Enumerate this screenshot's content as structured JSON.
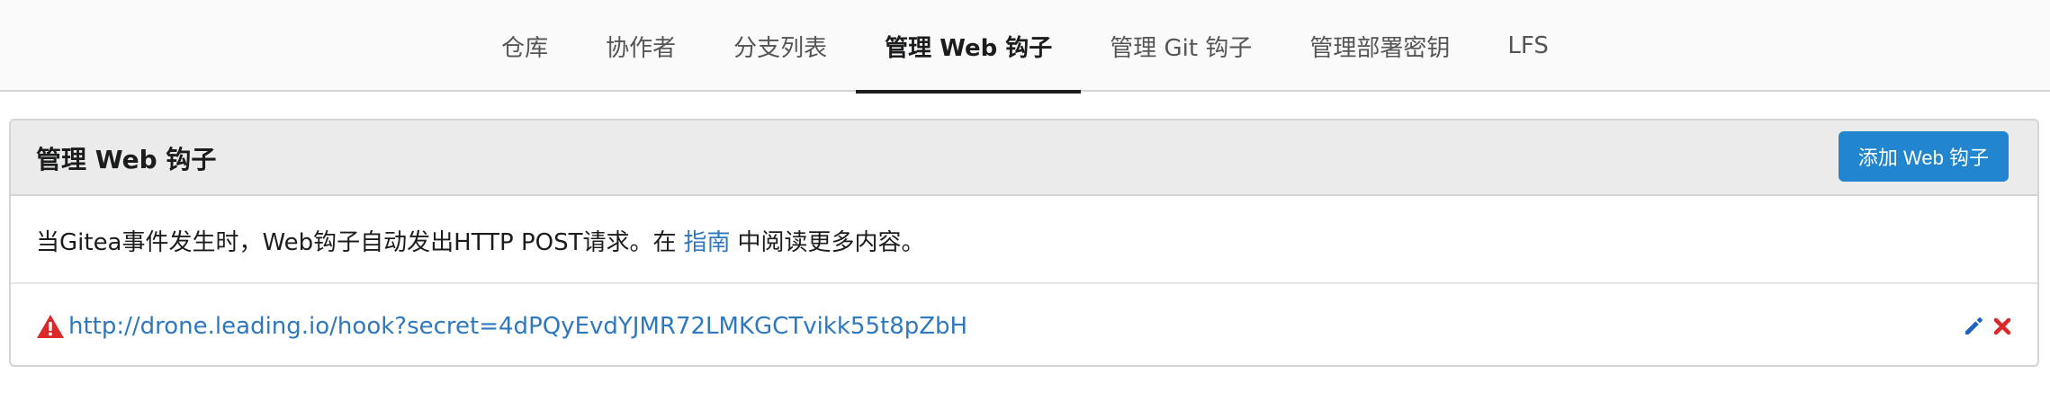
{
  "tabs": [
    {
      "label": "仓库",
      "active": false
    },
    {
      "label": "协作者",
      "active": false
    },
    {
      "label": "分支列表",
      "active": false
    },
    {
      "label": "管理 Web 钩子",
      "active": true
    },
    {
      "label": "管理 Git 钩子",
      "active": false
    },
    {
      "label": "管理部署密钥",
      "active": false
    },
    {
      "label": "LFS",
      "active": false
    }
  ],
  "panel": {
    "title": "管理 Web 钩子",
    "add_button_label": "添加 Web 钩子",
    "description_before": "当Gitea事件发生时，Web钩子自动发出HTTP POST请求。在",
    "description_link": "指南",
    "description_after": "中阅读更多内容。"
  },
  "hooks": [
    {
      "url": "http://drone.leading.io/hook?secret=4dPQyEvdYJMR72LMKGCTvikk55t8pZbH",
      "status_icon": "warning-icon",
      "actions": [
        "pencil-icon",
        "close-icon"
      ]
    }
  ],
  "colors": {
    "primary": "#2185d0",
    "link": "#2e78c0",
    "warning": "#db2828",
    "edit": "#1e63c4",
    "delete": "#db2828",
    "header_bg": "#ebebeb"
  }
}
